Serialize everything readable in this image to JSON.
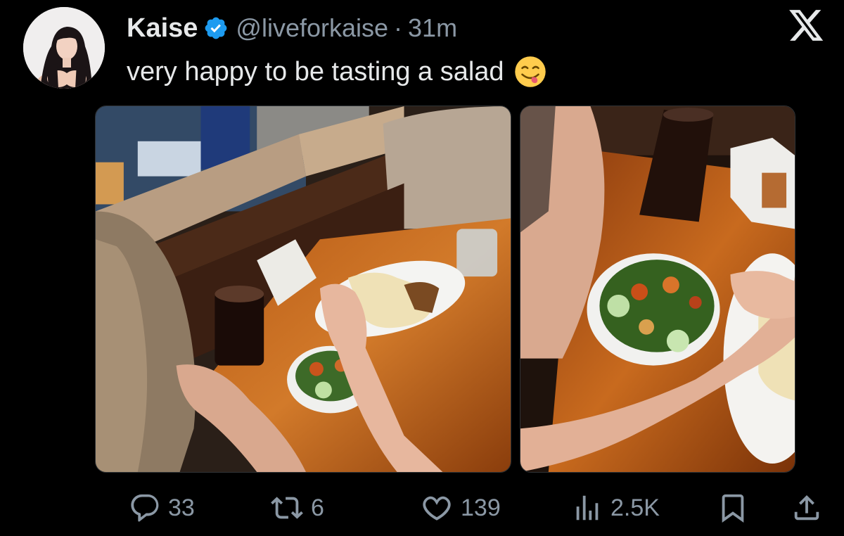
{
  "author": {
    "display_name": "Kaise",
    "handle": "@liveforkaise",
    "separator": "·",
    "timestamp": "31m",
    "verified": true,
    "avatar_icon": "avatar-photo"
  },
  "tweet": {
    "text": "very happy to be tasting a salad",
    "emoji_icon": "face-savoring-food-emoji"
  },
  "media": [
    {
      "name": "photo-restaurant-table",
      "icon": "photo"
    },
    {
      "name": "photo-salad-closeup",
      "icon": "photo"
    }
  ],
  "actions": {
    "replies": "33",
    "retweets": "6",
    "likes": "139",
    "views": "2.5K"
  },
  "icons": {
    "logo": "x-logo-icon",
    "reply": "reply-icon",
    "retweet": "retweet-icon",
    "like": "heart-icon",
    "views": "views-chart-icon",
    "bookmark": "bookmark-icon",
    "share": "share-icon"
  },
  "colors": {
    "background": "#000000",
    "text_primary": "#e7e9ea",
    "text_secondary": "#8b98a5",
    "verified_blue": "#1d9bf0"
  }
}
